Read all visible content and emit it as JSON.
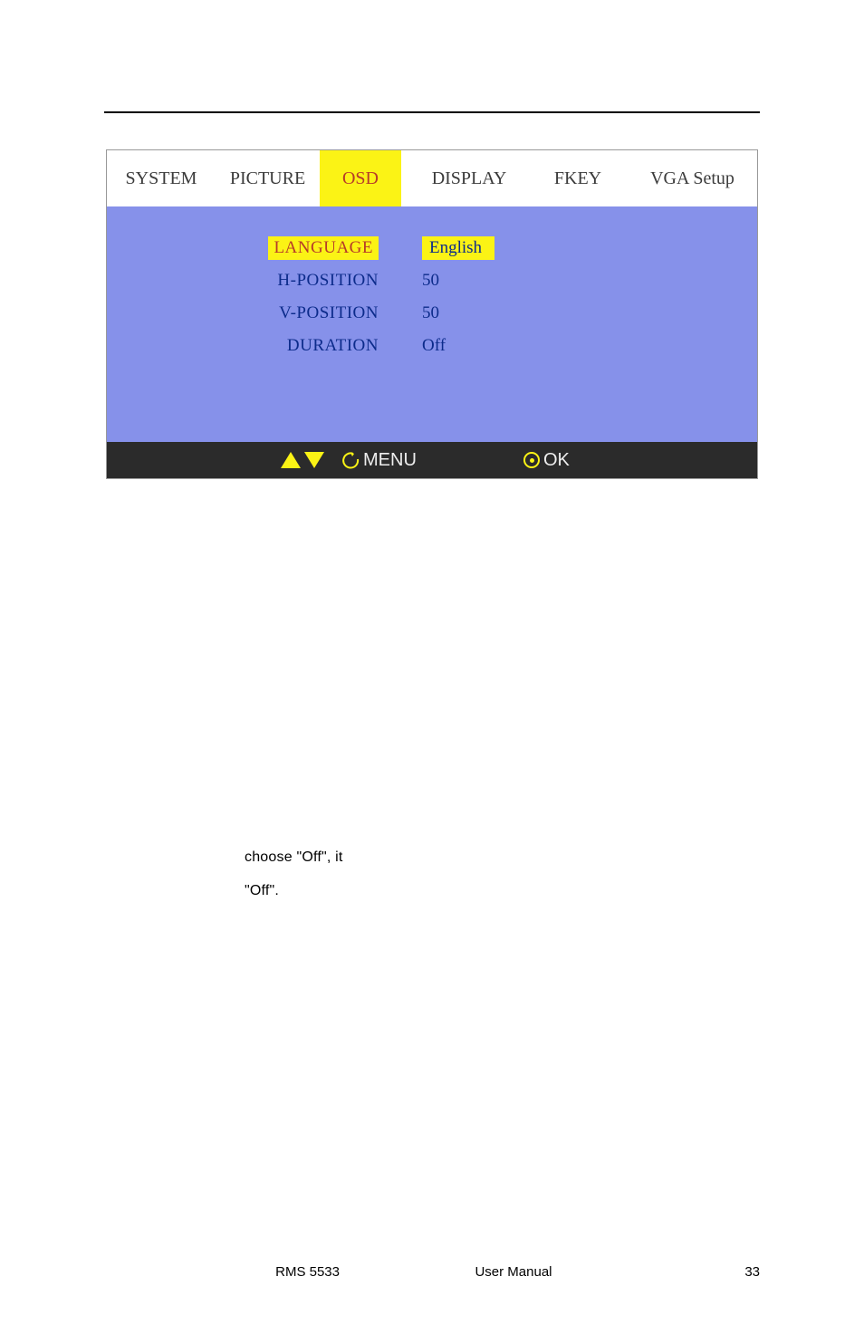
{
  "osd": {
    "tabs": {
      "system": "SYSTEM",
      "picture": "PICTURE",
      "osd": "OSD",
      "display": "DISPLAY",
      "fkey": "FKEY",
      "vga": "VGA Setup"
    },
    "rows": {
      "language_label": "LANGUAGE",
      "language_value": "English",
      "hpos_label": "H-POSITION",
      "hpos_value": "50",
      "vpos_label": "V-POSITION",
      "vpos_value": "50",
      "duration_label": "DURATION",
      "duration_value": "Off"
    },
    "footer": {
      "menu": "MENU",
      "ok": "OK"
    }
  },
  "body": {
    "line1": "choose \"Off\", it",
    "line2": "\"Off\"."
  },
  "footer": {
    "left": "RMS 5533",
    "center": "User Manual",
    "right": "33"
  }
}
